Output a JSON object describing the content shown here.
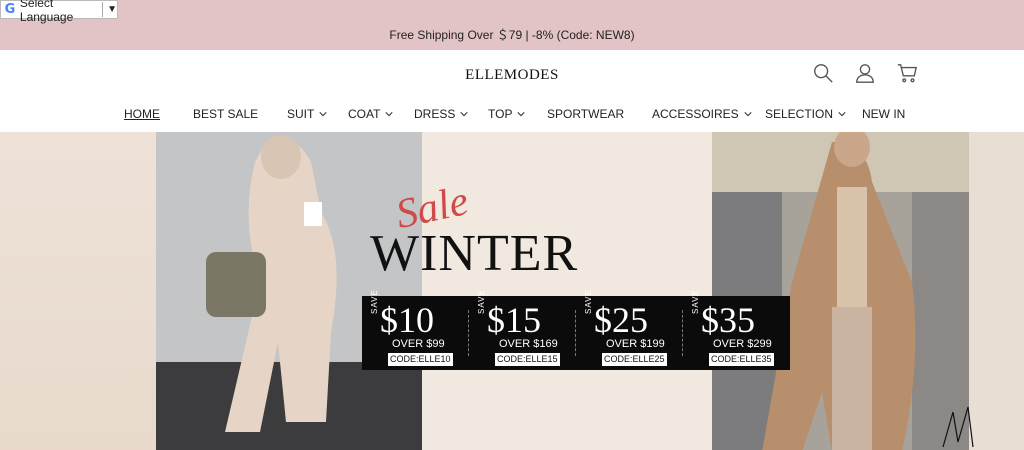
{
  "topbar": {
    "language_selector": {
      "label": "Select Language",
      "arrow": "▼",
      "icon": "google-icon"
    },
    "promo": "Free Shipping Over ＄79 | -8% (Code: NEW8)"
  },
  "header": {
    "logo": "ELLEMODES",
    "icons": [
      "search-icon",
      "user-icon",
      "cart-icon"
    ]
  },
  "nav": {
    "items": [
      {
        "label": "HOME",
        "has_dropdown": false
      },
      {
        "label": "BEST SALE",
        "has_dropdown": false
      },
      {
        "label": "SUIT",
        "has_dropdown": true
      },
      {
        "label": "COAT",
        "has_dropdown": true
      },
      {
        "label": "DRESS",
        "has_dropdown": true
      },
      {
        "label": "TOP",
        "has_dropdown": true
      },
      {
        "label": "SPORTWEAR",
        "has_dropdown": false
      },
      {
        "label": "ACCESSOIRES",
        "has_dropdown": true
      },
      {
        "label": "SELECTION",
        "has_dropdown": true
      },
      {
        "label": "NEW IN",
        "has_dropdown": false
      }
    ]
  },
  "hero": {
    "script_text": "Sale",
    "headline": "WINTER",
    "coupons": [
      {
        "save": "SAVE",
        "amount": "$10",
        "over": "OVER $99",
        "code": "CODE:ELLE10"
      },
      {
        "save": "SAVE",
        "amount": "$15",
        "over": "OVER $169",
        "code": "CODE:ELLE15"
      },
      {
        "save": "SAVE",
        "amount": "$25",
        "over": "OVER $199",
        "code": "CODE:ELLE25"
      },
      {
        "save": "SAVE",
        "amount": "$35",
        "over": "OVER $299",
        "code": "CODE:ELLE35"
      }
    ]
  },
  "colors": {
    "topbar_bg": "#e3c4c6",
    "coupon_bg": "#0b0b0b",
    "sale_script": "#d14a4a"
  }
}
